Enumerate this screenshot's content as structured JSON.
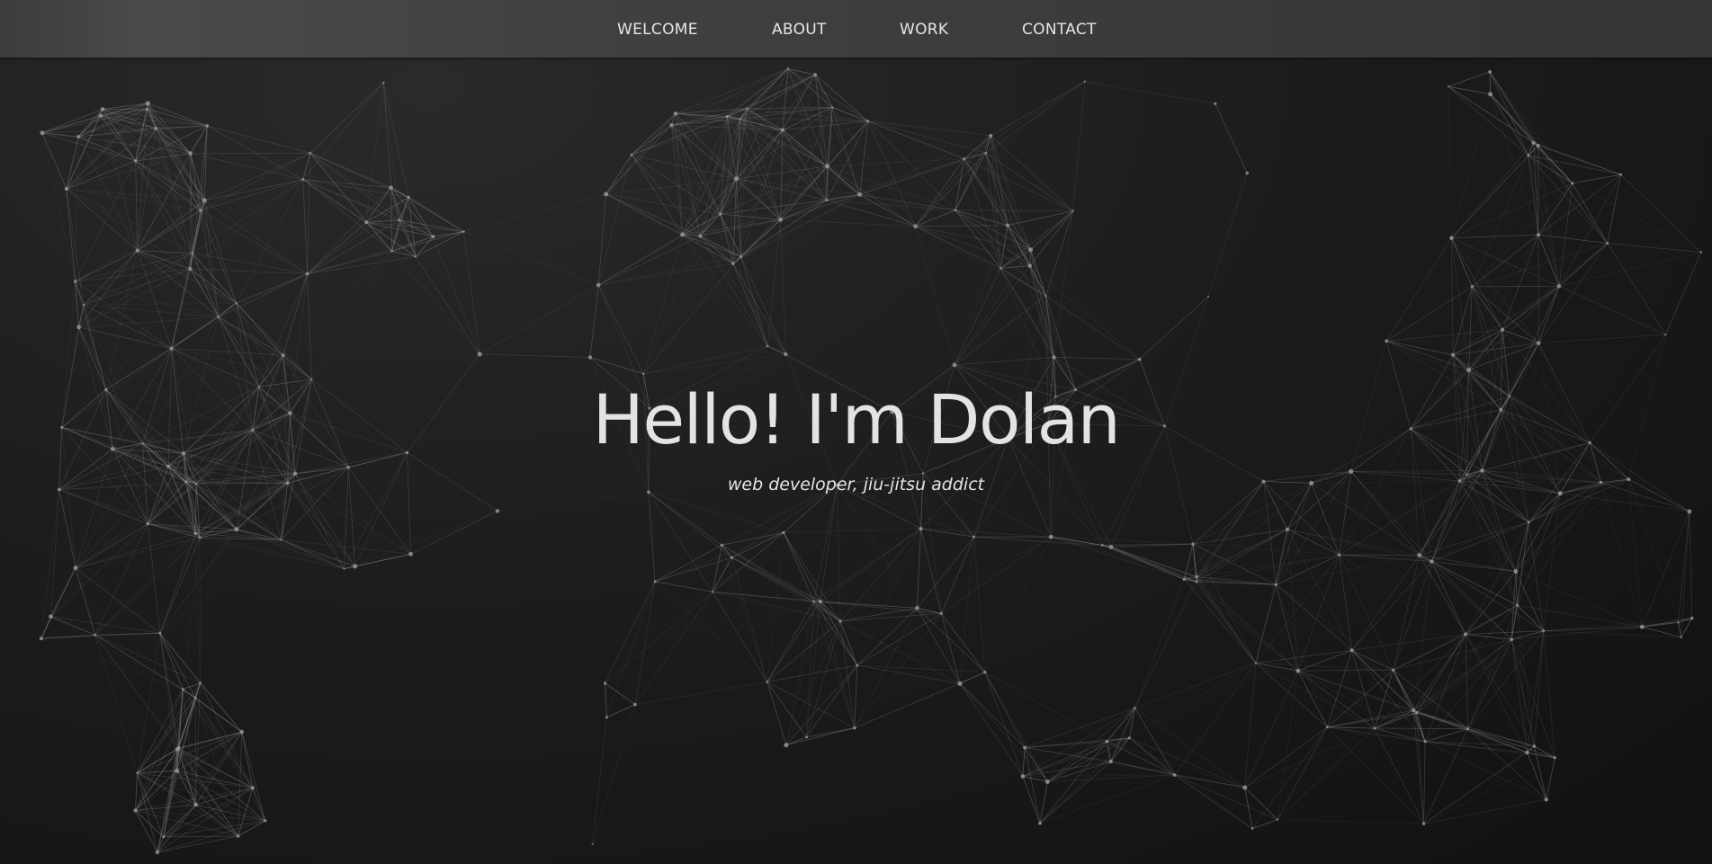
{
  "nav": {
    "items": [
      {
        "label": "WELCOME"
      },
      {
        "label": "ABOUT"
      },
      {
        "label": "WORK"
      },
      {
        "label": "CONTACT"
      }
    ]
  },
  "hero": {
    "title": "Hello! I'm Dolan",
    "subtitle": "web developer, jiu-jitsu addict"
  },
  "colors": {
    "background": "#1a1a1a",
    "nav_background": "#3f3f3f",
    "text": "#e3e3e3",
    "network_lines": "#8a8a8a"
  }
}
